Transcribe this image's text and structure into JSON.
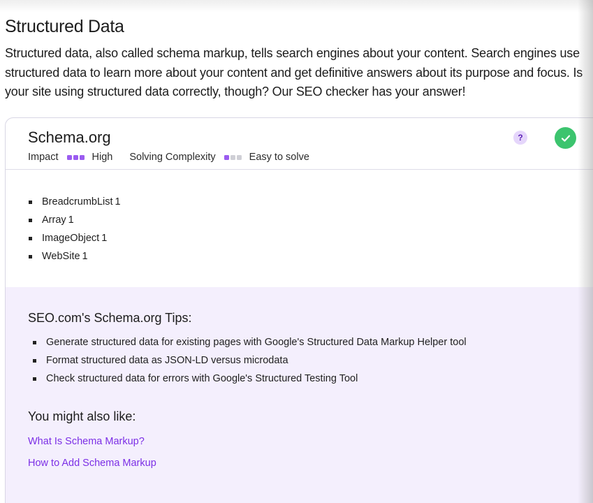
{
  "section": {
    "title": "Structured Data",
    "intro": "Structured data, also called schema markup, tells search engines about your content. Search engines use structured data to learn more about your content and get definitive answers about its purpose and focus. Is your site using structured data correctly, though? Our SEO checker has your answer!"
  },
  "card": {
    "title": "Schema.org",
    "impact_label": "Impact",
    "impact_value": "High",
    "impact_level": 3,
    "complexity_label": "Solving Complexity",
    "complexity_value": "Easy to solve",
    "complexity_level": 1,
    "help_glyph": "?",
    "status_icon": "check-circle-icon",
    "status_color": "#3cc46e",
    "accent_color": "#9b5cf0",
    "findings": [
      {
        "name": "BreadcrumbList",
        "count": "1"
      },
      {
        "name": "Array",
        "count": "1"
      },
      {
        "name": "ImageObject",
        "count": "1"
      },
      {
        "name": "WebSite",
        "count": "1"
      }
    ]
  },
  "tips": {
    "heading": "SEO.com's Schema.org Tips:",
    "items": [
      "Generate structured data for existing pages with Google's Structured Data Markup Helper tool",
      "Format structured data as JSON-LD versus microdata",
      "Check structured data for errors with Google's Structured Testing Tool"
    ],
    "panel_color": "#f4effd"
  },
  "related": {
    "heading": "You might also like:",
    "links": [
      "What Is Schema Markup?",
      "How to Add Schema Markup"
    ],
    "link_color": "#7c2fe6"
  }
}
